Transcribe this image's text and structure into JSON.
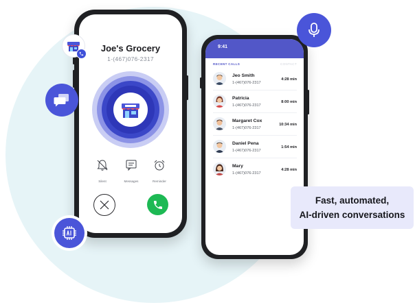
{
  "incoming_call": {
    "caller_name": "Joe's Grocery",
    "caller_number": "1-(467)076-2317",
    "actions": [
      {
        "label": "Silent",
        "icon": "bell-off-icon"
      },
      {
        "label": "Messages",
        "icon": "message-icon"
      },
      {
        "label": "Reminder",
        "icon": "alarm-clock-icon"
      }
    ],
    "decline_icon": "x-icon",
    "accept_icon": "phone-icon",
    "accept_color": "#1db954"
  },
  "recent_calls": {
    "status_time": "9:41",
    "header_left": "RECENT CALLS",
    "header_right": "CONTACT",
    "accent_color": "#5257c8",
    "items": [
      {
        "name": "Jeo Smith",
        "number": "1-(467)076-2317",
        "duration": "4:28 min"
      },
      {
        "name": "Patricia",
        "number": "1-(467)076-2317",
        "duration": "8:00 min"
      },
      {
        "name": "Margaret Cox",
        "number": "1-(467)076-2317",
        "duration": "10:34 min"
      },
      {
        "name": "Daniel Pena",
        "number": "1-(467)076-2317",
        "duration": "1:54 min"
      },
      {
        "name": "Mary",
        "number": "1-(467)076-2317",
        "duration": "4:28 min"
      }
    ]
  },
  "floating_icons": [
    "microphone-icon",
    "chat-icon",
    "ai-chip-icon",
    "store-icon"
  ],
  "tagline": {
    "line1": "Fast, automated,",
    "line2": "AI-driven conversations"
  },
  "colors": {
    "brand": "#4a55d9",
    "background_circle": "#e6f4f7",
    "ring_outer": "#c9cdf4",
    "ring_inner": "#3b47c8"
  }
}
